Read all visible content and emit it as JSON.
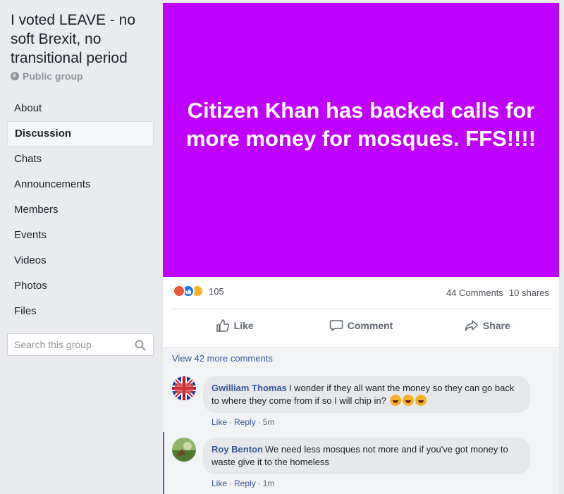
{
  "sidebar": {
    "group_title": "I voted LEAVE - no soft Brexit, no transitional period",
    "privacy": "Public group",
    "nav": [
      {
        "label": "About"
      },
      {
        "label": "Discussion"
      },
      {
        "label": "Chats"
      },
      {
        "label": "Announcements"
      },
      {
        "label": "Members"
      },
      {
        "label": "Events"
      },
      {
        "label": "Videos"
      },
      {
        "label": "Photos"
      },
      {
        "label": "Files"
      }
    ],
    "search_placeholder": "Search this group"
  },
  "post": {
    "image_text": "Citizen Khan has backed calls for more money for mosques. FFS!!!!",
    "image_bg": "#c000ff",
    "reaction_count": "105",
    "comments_count": "44 Comments",
    "shares_count": "10 shares",
    "actions": {
      "like": "Like",
      "comment": "Comment",
      "share": "Share"
    },
    "view_more": "View 42 more comments",
    "comments": [
      {
        "author": "Gwilliam Thomas",
        "text": "I wonder if they all want the money so they can go back to where they come from if so I will chip in?",
        "like": "Like",
        "reply": "Reply",
        "time": "5m"
      },
      {
        "author": "Roy Benton",
        "text": "We need less mosques not more and if you've got money to waste give it to the homeless",
        "like": "Like",
        "reply": "Reply",
        "time": "1m"
      }
    ]
  }
}
